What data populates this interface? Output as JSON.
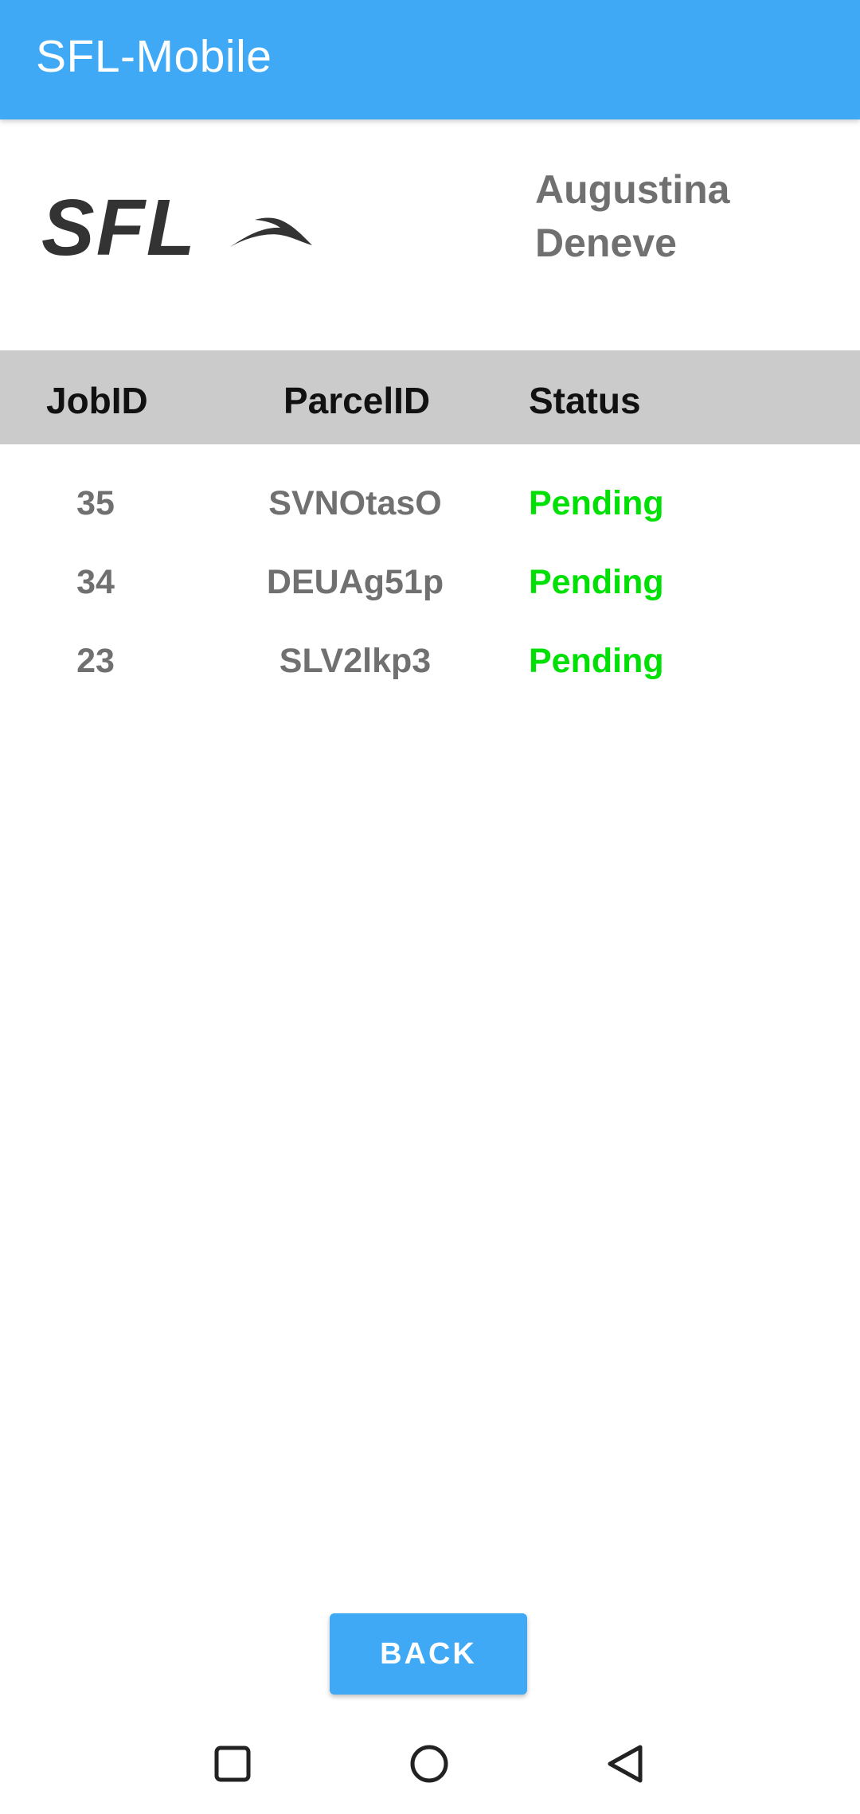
{
  "app_bar": {
    "title": "SFL-Mobile",
    "color": "#3fa9f5"
  },
  "header": {
    "logo_text": "SFL",
    "user": {
      "first_name": "Augustina",
      "last_name": "Deneve"
    }
  },
  "table": {
    "columns": [
      "JobID",
      "ParcelID",
      "Status"
    ],
    "rows": [
      {
        "job_id": "35",
        "parcel_id": "SVNOtasO",
        "status": "Pending"
      },
      {
        "job_id": "34",
        "parcel_id": "DEUAg51p",
        "status": "Pending"
      },
      {
        "job_id": "23",
        "parcel_id": "SLV2lkp3",
        "status": "Pending"
      }
    ],
    "status_color": "#00e005"
  },
  "footer": {
    "back_label": "BACK"
  },
  "system_nav": {
    "icons": [
      "recents-square-icon",
      "home-circle-icon",
      "back-triangle-icon"
    ]
  }
}
